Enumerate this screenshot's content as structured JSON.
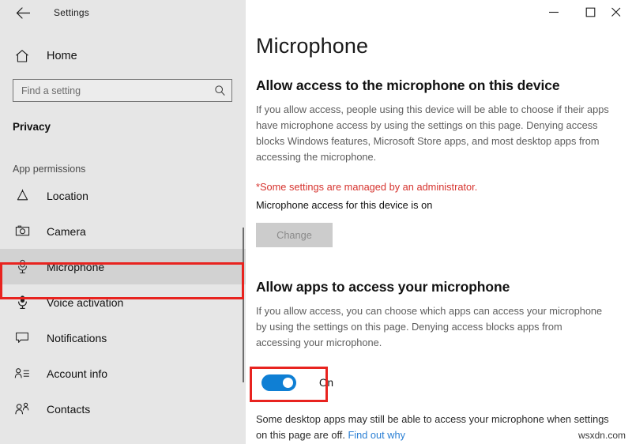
{
  "window": {
    "app_title": "Settings",
    "back_icon": "back-arrow-icon",
    "controls": {
      "minimize_label": "Minimize",
      "maximize_label": "Maximize",
      "close_label": "Close"
    }
  },
  "sidebar": {
    "home": {
      "label": "Home",
      "icon": "home-icon"
    },
    "search": {
      "value": "",
      "placeholder": "Find a setting",
      "icon": "search-icon"
    },
    "section_title": "Privacy",
    "group_label": "App permissions",
    "items": [
      {
        "label": "Location",
        "icon": "location-icon",
        "selected": false
      },
      {
        "label": "Camera",
        "icon": "camera-icon",
        "selected": false
      },
      {
        "label": "Microphone",
        "icon": "microphone-icon",
        "selected": true
      },
      {
        "label": "Voice activation",
        "icon": "voice-activation-icon",
        "selected": false
      },
      {
        "label": "Notifications",
        "icon": "notification-icon",
        "selected": false
      },
      {
        "label": "Account info",
        "icon": "account-info-icon",
        "selected": false
      },
      {
        "label": "Contacts",
        "icon": "contacts-icon",
        "selected": false
      }
    ]
  },
  "main": {
    "page_title": "Microphone",
    "device_section": {
      "heading": "Allow access to the microphone on this device",
      "description": "If you allow access, people using this device will be able to choose if their apps have microphone access by using the settings on this page. Denying access blocks Windows features, Microsoft Store apps, and most desktop apps from accessing the microphone.",
      "admin_note": "*Some settings are managed by an administrator.",
      "status": "Microphone access for this device is on",
      "change_button": "Change"
    },
    "apps_section": {
      "heading": "Allow apps to access your microphone",
      "description": "If you allow access, you can choose which apps can access your microphone by using the settings on this page. Denying access blocks apps from accessing your microphone.",
      "toggle_state": "On",
      "footnote_text": "Some desktop apps may still be able to access your microphone when settings on this page are off. ",
      "footnote_link": "Find out why"
    }
  },
  "annotations": {
    "highlight_color": "#e8231f",
    "nav_highlight_target": "Microphone",
    "toggle_highlight_target": "On"
  },
  "watermark": "wsxdn.com",
  "colors": {
    "sidebar_bg": "#e6e6e6",
    "selected_bg": "#d2d2d2",
    "accent_blue": "#0f7fd4",
    "link_blue": "#2a7fd4",
    "admin_red": "#d6332e",
    "highlight_red": "#e8231f"
  }
}
